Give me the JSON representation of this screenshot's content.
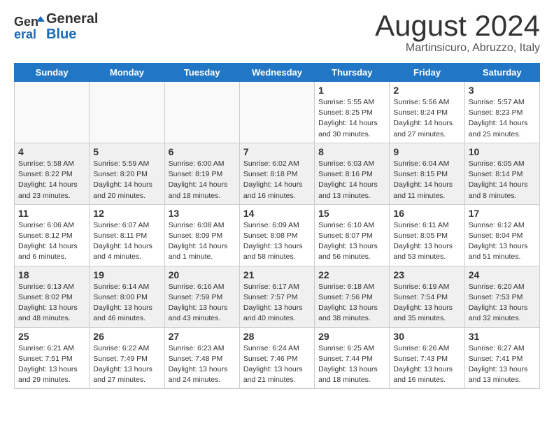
{
  "header": {
    "logo_line1": "General",
    "logo_line2": "Blue",
    "month_title": "August 2024",
    "location": "Martinsicuro, Abruzzo, Italy"
  },
  "weekdays": [
    "Sunday",
    "Monday",
    "Tuesday",
    "Wednesday",
    "Thursday",
    "Friday",
    "Saturday"
  ],
  "weeks": [
    [
      {
        "day": "",
        "info": ""
      },
      {
        "day": "",
        "info": ""
      },
      {
        "day": "",
        "info": ""
      },
      {
        "day": "",
        "info": ""
      },
      {
        "day": "1",
        "info": "Sunrise: 5:55 AM\nSunset: 8:25 PM\nDaylight: 14 hours\nand 30 minutes."
      },
      {
        "day": "2",
        "info": "Sunrise: 5:56 AM\nSunset: 8:24 PM\nDaylight: 14 hours\nand 27 minutes."
      },
      {
        "day": "3",
        "info": "Sunrise: 5:57 AM\nSunset: 8:23 PM\nDaylight: 14 hours\nand 25 minutes."
      }
    ],
    [
      {
        "day": "4",
        "info": "Sunrise: 5:58 AM\nSunset: 8:22 PM\nDaylight: 14 hours\nand 23 minutes."
      },
      {
        "day": "5",
        "info": "Sunrise: 5:59 AM\nSunset: 8:20 PM\nDaylight: 14 hours\nand 20 minutes."
      },
      {
        "day": "6",
        "info": "Sunrise: 6:00 AM\nSunset: 8:19 PM\nDaylight: 14 hours\nand 18 minutes."
      },
      {
        "day": "7",
        "info": "Sunrise: 6:02 AM\nSunset: 8:18 PM\nDaylight: 14 hours\nand 16 minutes."
      },
      {
        "day": "8",
        "info": "Sunrise: 6:03 AM\nSunset: 8:16 PM\nDaylight: 14 hours\nand 13 minutes."
      },
      {
        "day": "9",
        "info": "Sunrise: 6:04 AM\nSunset: 8:15 PM\nDaylight: 14 hours\nand 11 minutes."
      },
      {
        "day": "10",
        "info": "Sunrise: 6:05 AM\nSunset: 8:14 PM\nDaylight: 14 hours\nand 8 minutes."
      }
    ],
    [
      {
        "day": "11",
        "info": "Sunrise: 6:06 AM\nSunset: 8:12 PM\nDaylight: 14 hours\nand 6 minutes."
      },
      {
        "day": "12",
        "info": "Sunrise: 6:07 AM\nSunset: 8:11 PM\nDaylight: 14 hours\nand 4 minutes."
      },
      {
        "day": "13",
        "info": "Sunrise: 6:08 AM\nSunset: 8:09 PM\nDaylight: 14 hours\nand 1 minute."
      },
      {
        "day": "14",
        "info": "Sunrise: 6:09 AM\nSunset: 8:08 PM\nDaylight: 13 hours\nand 58 minutes."
      },
      {
        "day": "15",
        "info": "Sunrise: 6:10 AM\nSunset: 8:07 PM\nDaylight: 13 hours\nand 56 minutes."
      },
      {
        "day": "16",
        "info": "Sunrise: 6:11 AM\nSunset: 8:05 PM\nDaylight: 13 hours\nand 53 minutes."
      },
      {
        "day": "17",
        "info": "Sunrise: 6:12 AM\nSunset: 8:04 PM\nDaylight: 13 hours\nand 51 minutes."
      }
    ],
    [
      {
        "day": "18",
        "info": "Sunrise: 6:13 AM\nSunset: 8:02 PM\nDaylight: 13 hours\nand 48 minutes."
      },
      {
        "day": "19",
        "info": "Sunrise: 6:14 AM\nSunset: 8:00 PM\nDaylight: 13 hours\nand 46 minutes."
      },
      {
        "day": "20",
        "info": "Sunrise: 6:16 AM\nSunset: 7:59 PM\nDaylight: 13 hours\nand 43 minutes."
      },
      {
        "day": "21",
        "info": "Sunrise: 6:17 AM\nSunset: 7:57 PM\nDaylight: 13 hours\nand 40 minutes."
      },
      {
        "day": "22",
        "info": "Sunrise: 6:18 AM\nSunset: 7:56 PM\nDaylight: 13 hours\nand 38 minutes."
      },
      {
        "day": "23",
        "info": "Sunrise: 6:19 AM\nSunset: 7:54 PM\nDaylight: 13 hours\nand 35 minutes."
      },
      {
        "day": "24",
        "info": "Sunrise: 6:20 AM\nSunset: 7:53 PM\nDaylight: 13 hours\nand 32 minutes."
      }
    ],
    [
      {
        "day": "25",
        "info": "Sunrise: 6:21 AM\nSunset: 7:51 PM\nDaylight: 13 hours\nand 29 minutes."
      },
      {
        "day": "26",
        "info": "Sunrise: 6:22 AM\nSunset: 7:49 PM\nDaylight: 13 hours\nand 27 minutes."
      },
      {
        "day": "27",
        "info": "Sunrise: 6:23 AM\nSunset: 7:48 PM\nDaylight: 13 hours\nand 24 minutes."
      },
      {
        "day": "28",
        "info": "Sunrise: 6:24 AM\nSunset: 7:46 PM\nDaylight: 13 hours\nand 21 minutes."
      },
      {
        "day": "29",
        "info": "Sunrise: 6:25 AM\nSunset: 7:44 PM\nDaylight: 13 hours\nand 18 minutes."
      },
      {
        "day": "30",
        "info": "Sunrise: 6:26 AM\nSunset: 7:43 PM\nDaylight: 13 hours\nand 16 minutes."
      },
      {
        "day": "31",
        "info": "Sunrise: 6:27 AM\nSunset: 7:41 PM\nDaylight: 13 hours\nand 13 minutes."
      }
    ]
  ]
}
